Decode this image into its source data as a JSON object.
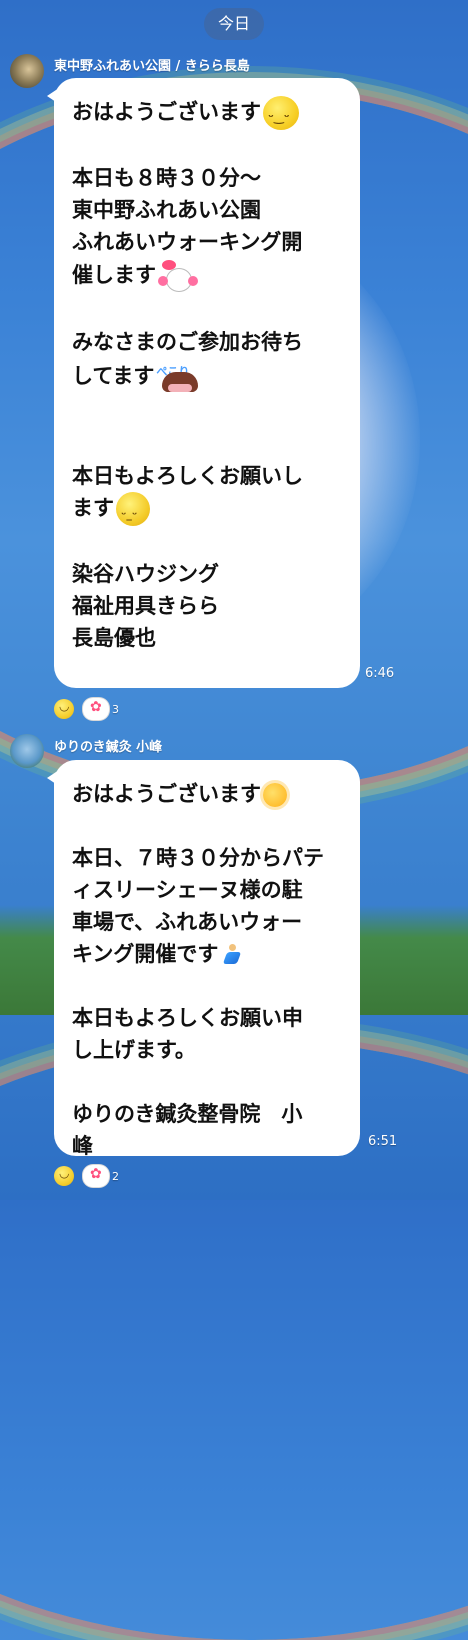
{
  "date_divider": {
    "label": "今日"
  },
  "messages": [
    {
      "sender": "東中野ふれあい公園 / きらら長島",
      "avatar_icon": "avatar-photo",
      "lines": [
        "おはようございます",
        "",
        "本日も８時３０分〜",
        "東中野ふれあい公園",
        "ふれあいウォーキング開",
        "催します",
        "",
        "みなさまのご参加お待ち",
        "してます",
        "",
        "",
        "本日もよろしくお願いし",
        "ます",
        "",
        "染谷ハウジング",
        "福祉用具きらら",
        "長島優也"
      ],
      "time": "6:46",
      "reactions": [
        {
          "icon": "smiley-reaction-icon"
        },
        {
          "icon": "cheer-reaction-icon",
          "count": "3"
        }
      ]
    },
    {
      "sender": "ゆりのき鍼灸 小峰",
      "avatar_icon": "avatar-photo",
      "lines": [
        "おはようございます",
        "",
        "本日、７時３０分からパテ",
        "ィスリーシェーヌ様の駐",
        "車場で、ふれあいウォー",
        "キング開催です",
        "",
        "本日もよろしくお願い申",
        "し上げます。",
        "",
        "ゆりのき鍼灸整骨院　小",
        "峰"
      ],
      "time": "6:51",
      "reactions": [
        {
          "icon": "smiley-reaction-icon"
        },
        {
          "icon": "cheer-reaction-icon",
          "count": "2"
        }
      ]
    }
  ],
  "stickers": {
    "pekori_text": "ぺこり"
  },
  "colors": {
    "bubble": "#ffffff",
    "background": "#3b82d6",
    "date_chip": "rgba(70,100,150,0.55)"
  }
}
